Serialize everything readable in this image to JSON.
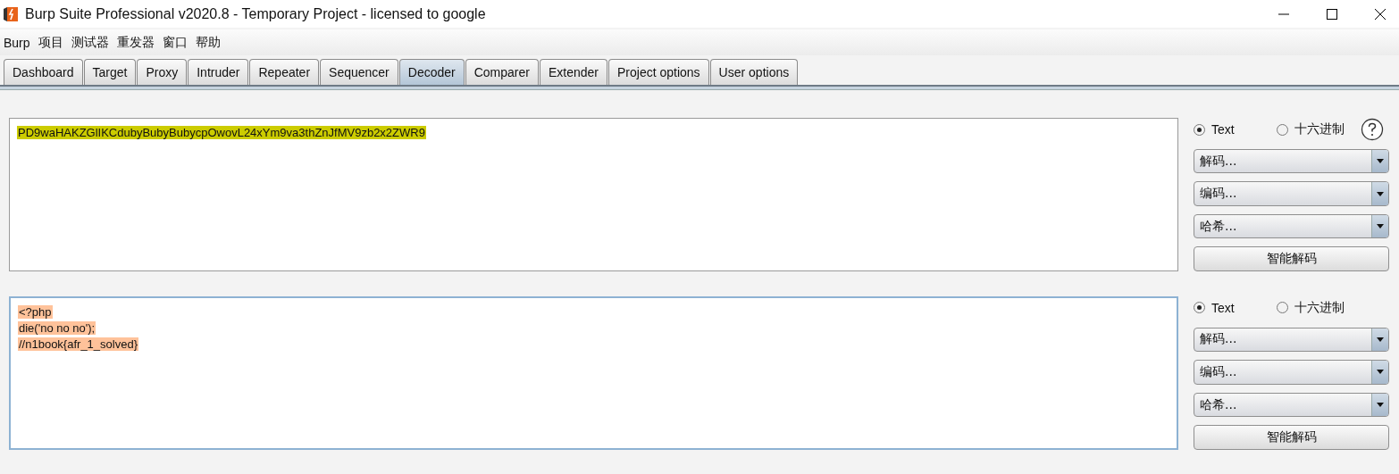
{
  "window": {
    "title": "Burp Suite Professional v2020.8 - Temporary Project - licensed to google"
  },
  "menu": [
    "Burp",
    "项目",
    "测试器",
    "重发器",
    "窗口",
    "帮助"
  ],
  "tabs": [
    {
      "label": "Dashboard",
      "selected": false
    },
    {
      "label": "Target",
      "selected": false
    },
    {
      "label": "Proxy",
      "selected": false
    },
    {
      "label": "Intruder",
      "selected": false
    },
    {
      "label": "Repeater",
      "selected": false
    },
    {
      "label": "Sequencer",
      "selected": false
    },
    {
      "label": "Decoder",
      "selected": true
    },
    {
      "label": "Comparer",
      "selected": false
    },
    {
      "label": "Extender",
      "selected": false
    },
    {
      "label": "Project options",
      "selected": false
    },
    {
      "label": "User options",
      "selected": false
    }
  ],
  "panels": [
    {
      "focused": false,
      "color": "#cccc00",
      "lines": [
        "PD9waHAKZGlIKCdubyBubyBubycpOwovL24xYm9va3thZnJfMV9zb2x2ZWR9"
      ],
      "formats": [
        {
          "label": "Text",
          "selected": true
        },
        {
          "label": "十六进制",
          "selected": false
        }
      ],
      "help": true,
      "dropdowns": [
        "解码...",
        "编码...",
        "哈希..."
      ],
      "button": "智能解码"
    },
    {
      "focused": true,
      "color": "#ffc29a",
      "lines": [
        "<?php",
        "die('no no no');",
        "//n1book{afr_1_solved}"
      ],
      "formats": [
        {
          "label": "Text",
          "selected": true
        },
        {
          "label": "十六进制",
          "selected": false
        }
      ],
      "help": false,
      "dropdowns": [
        "解码...",
        "编码...",
        "哈希..."
      ],
      "button": "智能解码"
    }
  ]
}
